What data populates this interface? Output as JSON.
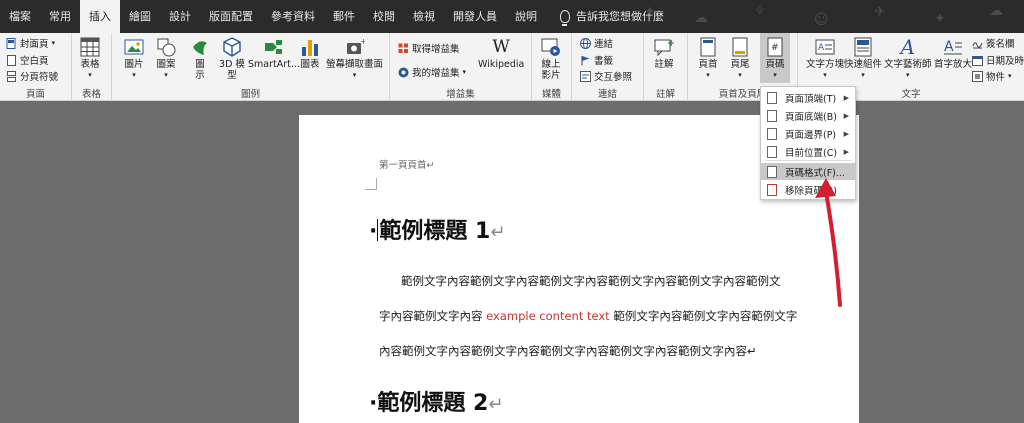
{
  "tabs": [
    "檔案",
    "常用",
    "插入",
    "繪圖",
    "設計",
    "版面配置",
    "參考資料",
    "郵件",
    "校閱",
    "檢視",
    "開發人員",
    "說明"
  ],
  "active_tab": "插入",
  "tell_me": "告訴我您想做什麼",
  "ribbon": {
    "pages": {
      "cover": "封面頁",
      "blank": "空白頁",
      "break": "分頁符號",
      "label": "頁面"
    },
    "tables": {
      "table": "表格",
      "label": "表格"
    },
    "illustrations": {
      "pictures": "圖片",
      "shapes": "圖案",
      "icons": "圖示",
      "models": "3D 模型",
      "smartart": "SmartArt...",
      "chart": "圖表",
      "screenshot": "螢幕擷取畫面",
      "label": "圖例"
    },
    "addins": {
      "get": "取得增益集",
      "my": "我的增益集",
      "wikipedia": "Wikipedia",
      "label": "增益集"
    },
    "media": {
      "online_video": "線上影片",
      "label": "媒體"
    },
    "links": {
      "link": "連結",
      "bookmark": "書籤",
      "cross_ref": "交互參照",
      "label": "連結"
    },
    "comments": {
      "comment": "註解",
      "label": "註解"
    },
    "header_footer": {
      "header": "頁首",
      "footer": "頁尾",
      "page_number": "頁碼",
      "label": "頁首及頁尾"
    },
    "text": {
      "textbox": "文字方塊",
      "quick_parts": "快速組件",
      "wordart": "文字藝術師",
      "dropcap": "首字放大",
      "signature": "簽名欄",
      "datetime": "日期及時",
      "object": "物件",
      "label": "文字"
    }
  },
  "menu": {
    "items": [
      "頁面頂端(T)",
      "頁面底端(B)",
      "頁面邊界(P)",
      "目前位置(C)",
      "頁碼格式(F)...",
      "移除頁碼(R)"
    ],
    "highlighted_index": 4
  },
  "document": {
    "header_text": "第一頁頁首↵",
    "heading1": "範例標題 1",
    "heading2": "範例標題 2",
    "para_line1": "範例文字內容範例文字內容範例文字內容範例文字內容範例文字內容範例文",
    "para_line2_a": "字內容範例文字內容",
    "para_line2_red": "example content text",
    "para_line2_b": "範例文字內容範例文字內容範例文字",
    "para_line3": "內容範例文字內容範例文字內容範例文字內容範例文字內容範例文字內容↵"
  },
  "colors": {
    "accent_red": "#d32030",
    "tab_bar": "#2b2b2b",
    "ribbon": "#f3f3f3"
  }
}
